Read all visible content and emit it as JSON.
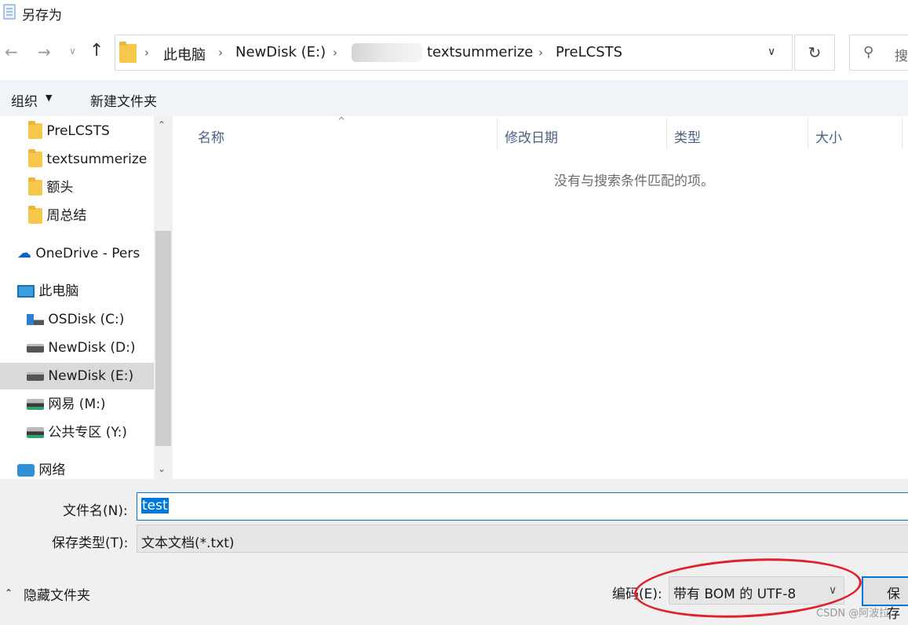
{
  "window": {
    "title": "另存为"
  },
  "address": {
    "crumbs": [
      "此电脑",
      "NewDisk (E:)",
      "textsummerize",
      "PreLCSTS"
    ],
    "search_placeholder": "搜"
  },
  "toolbar": {
    "organize": "组织",
    "new_folder": "新建文件夹"
  },
  "nav": {
    "items": [
      {
        "label": "PreLCSTS",
        "icon": "folder-icon"
      },
      {
        "label": "textsummerize",
        "icon": "folder-icon"
      },
      {
        "label": "额头",
        "icon": "folder-icon"
      },
      {
        "label": "周总结",
        "icon": "folder-icon"
      },
      {
        "label": "OneDrive - Pers",
        "icon": "onedrive-icon"
      },
      {
        "label": "此电脑",
        "icon": "computer-icon"
      },
      {
        "label": "OSDisk (C:)",
        "icon": "os-drive-icon"
      },
      {
        "label": "NewDisk (D:)",
        "icon": "drive-icon"
      },
      {
        "label": "NewDisk (E:)",
        "icon": "drive-icon",
        "selected": true
      },
      {
        "label": "网易 (M:)",
        "icon": "network-drive-icon"
      },
      {
        "label": "公共专区 (Y:)",
        "icon": "network-drive-icon"
      },
      {
        "label": "网络",
        "icon": "network-icon"
      }
    ]
  },
  "filelist": {
    "columns": [
      "名称",
      "修改日期",
      "类型",
      "大小"
    ],
    "empty_message": "没有与搜索条件匹配的项。"
  },
  "form": {
    "filename_label": "文件名(N):",
    "filename_value": "test",
    "type_label": "保存类型(T):",
    "type_value": "文本文档(*.txt)",
    "hide_folders": "隐藏文件夹",
    "encoding_label": "编码(E):",
    "encoding_value": "带有 BOM 的 UTF-8",
    "save_button": "保存"
  },
  "watermark": "CSDN @阿波拉",
  "colors": {
    "accent": "#0078d7",
    "annotation": "#e0202a",
    "toolbar_bg": "#f0f4f9"
  }
}
